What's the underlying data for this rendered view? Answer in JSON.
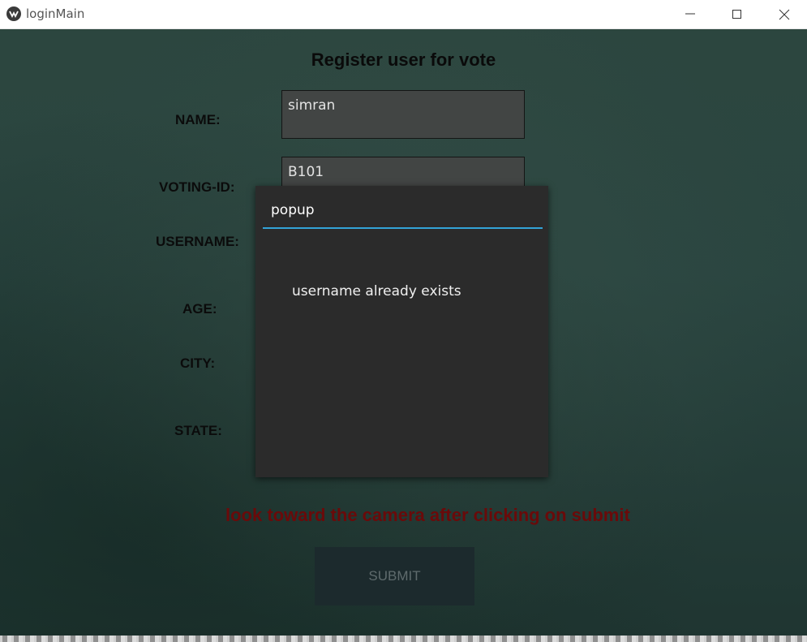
{
  "window": {
    "title": "loginMain",
    "icon": "kivy-logo-icon",
    "controls": [
      "minimize-icon",
      "maximize-icon",
      "close-icon"
    ]
  },
  "form": {
    "title": "Register user for vote",
    "labels": {
      "name": "NAME:",
      "voting_id": "VOTING-ID:",
      "username": "USERNAME:",
      "age": "AGE:",
      "city": "CITY:",
      "state": "STATE:"
    },
    "values": {
      "name": "simran",
      "voting_id": "B101"
    },
    "warning": "look toward the camera after clicking on submit",
    "submit_label": "SUBMIT"
  },
  "popup": {
    "title": "popup",
    "message": "username already exists"
  },
  "colors": {
    "background": "#2a4540",
    "field": "#424544",
    "popup": "#2b2b2b",
    "popup_accent": "#33a3d7",
    "warning": "#6a0a0a",
    "submit_bg": "#1c2a2d"
  }
}
